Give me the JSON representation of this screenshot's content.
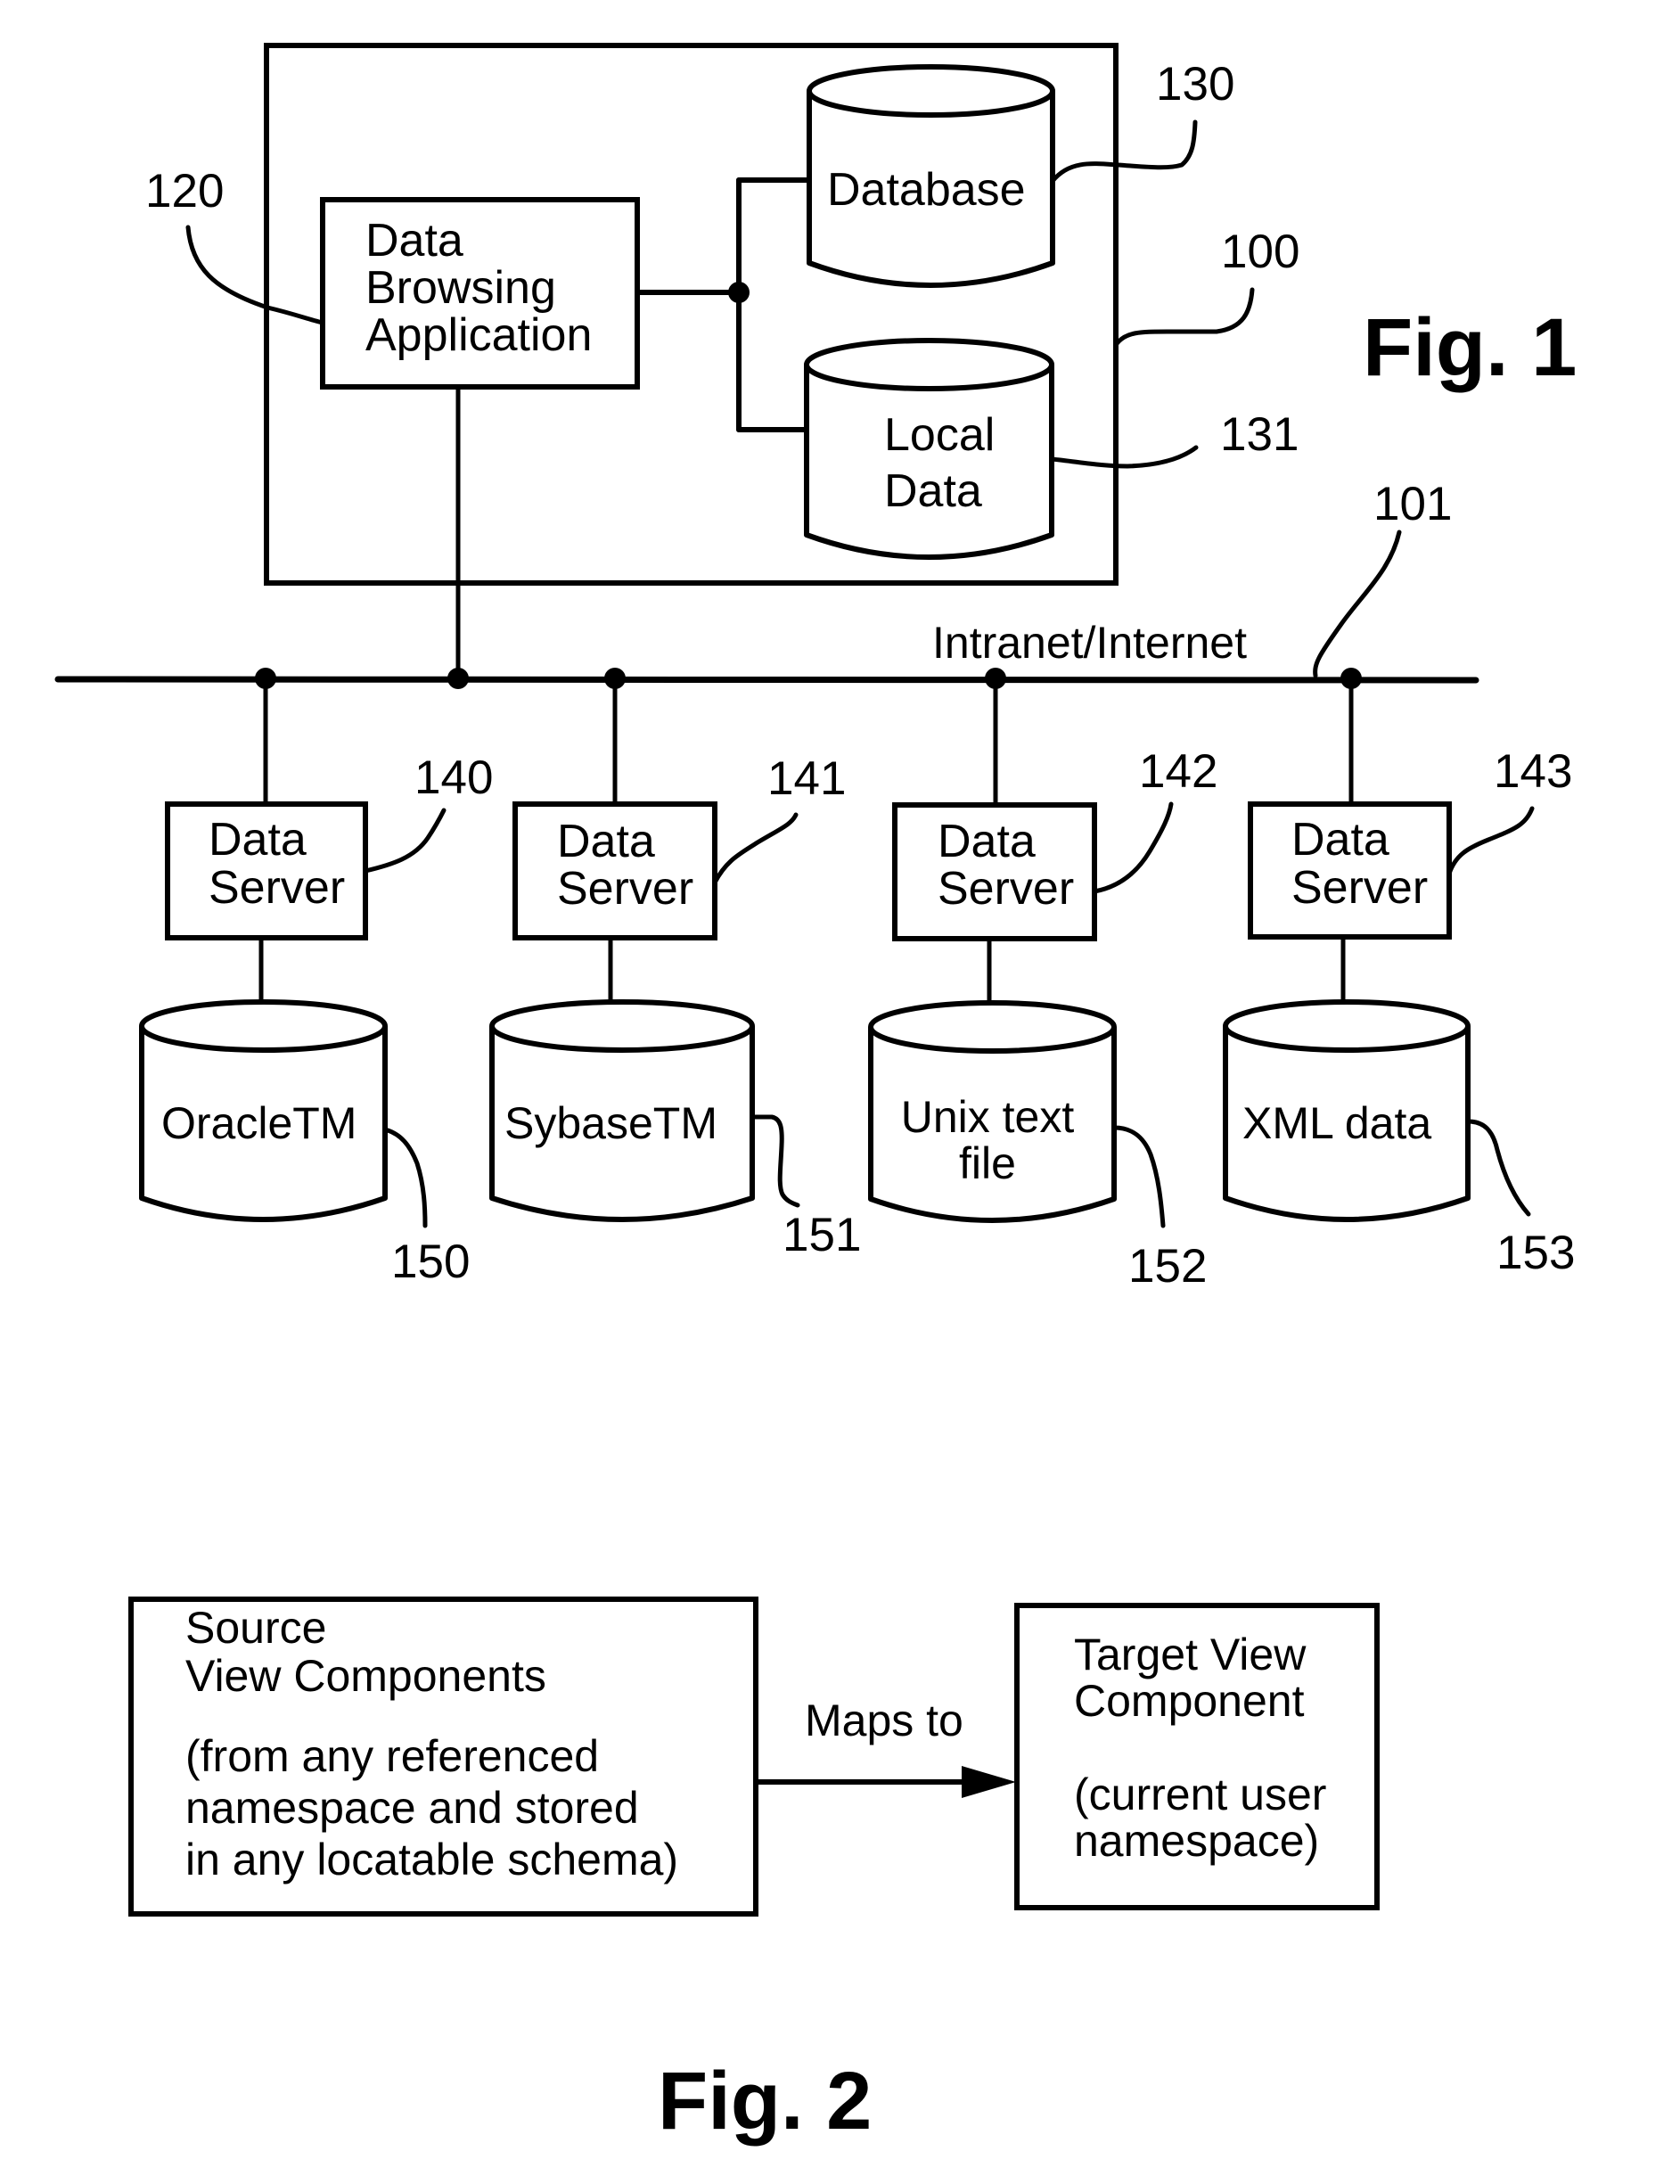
{
  "figure1": {
    "title": "Fig. 1",
    "system": {
      "ref": "100"
    },
    "app": {
      "ref": "120",
      "lines": [
        "Data",
        "Browsing",
        "Application"
      ]
    },
    "database": {
      "ref": "130",
      "label": "Database"
    },
    "local_data": {
      "ref": "131",
      "lines": [
        "Local",
        "Data"
      ]
    },
    "network": {
      "ref": "101",
      "label": "Intranet/Internet"
    },
    "servers": [
      {
        "ref": "140",
        "lines": [
          "Data",
          "Server"
        ]
      },
      {
        "ref": "141",
        "lines": [
          "Data",
          "Server"
        ]
      },
      {
        "ref": "142",
        "lines": [
          "Data",
          "Server"
        ]
      },
      {
        "ref": "143",
        "lines": [
          "Data",
          "Server"
        ]
      }
    ],
    "stores": [
      {
        "ref": "150",
        "lines": [
          "OracleTM"
        ]
      },
      {
        "ref": "151",
        "lines": [
          "SybaseTM"
        ]
      },
      {
        "ref": "152",
        "lines": [
          "Unix text",
          "file"
        ]
      },
      {
        "ref": "153",
        "lines": [
          "XML data"
        ]
      }
    ]
  },
  "figure2": {
    "title": "Fig. 2",
    "source": {
      "lines": [
        "Source",
        "View Components",
        "",
        "(from any referenced",
        "namespace and stored",
        "in any locatable schema)"
      ]
    },
    "arrow_label": "Maps to",
    "target": {
      "lines": [
        "Target View",
        "Component",
        "",
        "(current user",
        "namespace)"
      ]
    }
  }
}
